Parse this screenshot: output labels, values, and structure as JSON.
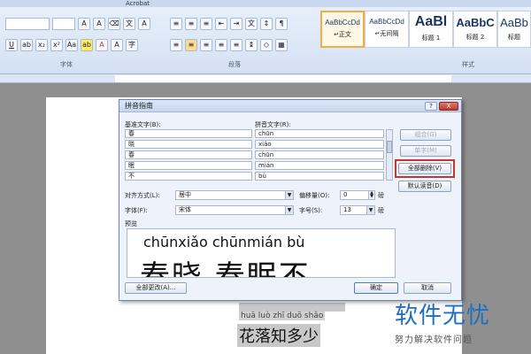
{
  "ribbon": {
    "tabs": [
      "",
      "",
      "",
      "",
      "",
      "Acrobat"
    ],
    "group_font": "字体",
    "group_paragraph": "段落",
    "group_styles": "样式",
    "styles": [
      {
        "sample": "AaBbCcDd",
        "name": "↵正文"
      },
      {
        "sample": "AaBbCcDd",
        "name": "↵无间隔"
      },
      {
        "sample": "AaBl",
        "name": "标题 1"
      },
      {
        "sample": "AaBbC",
        "name": "标题 2"
      },
      {
        "sample": "AaBb",
        "name": "标题"
      }
    ]
  },
  "dialog": {
    "title": "拼音指南",
    "help_label": "?",
    "close_label": "X",
    "base_text_label": "基准文字(B):",
    "ruby_text_label": "拼音文字(R):",
    "rows": [
      {
        "base": "春",
        "ruby": "chūn"
      },
      {
        "base": "晓",
        "ruby": "xiǎo"
      },
      {
        "base": "春",
        "ruby": "chūn"
      },
      {
        "base": "眠",
        "ruby": "mián"
      },
      {
        "base": "不",
        "ruby": "bù"
      }
    ],
    "btn_combine": "组合(G)",
    "btn_single": "单字(M)",
    "btn_clear_all": "全部删除(V)",
    "btn_default": "默认读音(D)",
    "alignment_label": "对齐方式(L):",
    "alignment_value": "居中",
    "offset_label": "偏移量(O):",
    "offset_value": "0",
    "offset_unit": "磅",
    "font_label": "字体(F):",
    "font_value": "宋体",
    "size_label": "字号(S):",
    "size_value": "13",
    "size_unit": "磅",
    "preview_label": "预览",
    "preview_pinyin": "chūnxiǎo  chūnmián bù",
    "preview_chars": "春晓 春眠不",
    "btn_change_all": "全部更改(A)...",
    "btn_ok": "确定",
    "btn_cancel": "取消"
  },
  "document": {
    "pinyin_line": "huā luò zhī duō shǎo",
    "chars_line": "花落知多少"
  },
  "watermark": {
    "title": "软件无忧",
    "subtitle": "努力解决软件问题"
  }
}
